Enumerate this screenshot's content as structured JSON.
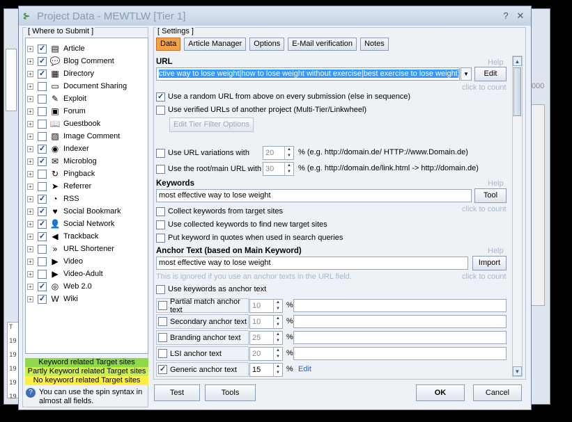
{
  "window": {
    "title": "Project Data - MEWTLW [Tier 1]"
  },
  "background": {
    "bottom_rows": [
      "T",
      "19",
      "19",
      "19",
      "19",
      "19"
    ],
    "right_text": "000"
  },
  "left_panel": {
    "label": "[ Where to Submit ]",
    "items": [
      {
        "label": "Article",
        "checked": true,
        "icon": "article-icon",
        "glyph": "▤"
      },
      {
        "label": "Blog Comment",
        "checked": true,
        "icon": "blog-comment-icon",
        "glyph": "💬"
      },
      {
        "label": "Directory",
        "checked": true,
        "icon": "directory-icon",
        "glyph": "▦"
      },
      {
        "label": "Document Sharing",
        "checked": false,
        "icon": "document-sharing-icon",
        "glyph": "▭"
      },
      {
        "label": "Exploit",
        "checked": false,
        "icon": "exploit-icon",
        "glyph": "✎"
      },
      {
        "label": "Forum",
        "checked": false,
        "icon": "forum-icon",
        "glyph": "▣"
      },
      {
        "label": "Guestbook",
        "checked": false,
        "icon": "guestbook-icon",
        "glyph": "📖"
      },
      {
        "label": "Image Comment",
        "checked": false,
        "icon": "image-comment-icon",
        "glyph": "▨"
      },
      {
        "label": "Indexer",
        "checked": true,
        "icon": "indexer-icon",
        "glyph": "◉"
      },
      {
        "label": "Microblog",
        "checked": true,
        "icon": "microblog-icon",
        "glyph": "✉"
      },
      {
        "label": "Pingback",
        "checked": false,
        "icon": "pingback-icon",
        "glyph": "↻"
      },
      {
        "label": "Referrer",
        "checked": false,
        "icon": "referrer-icon",
        "glyph": "➤"
      },
      {
        "label": "RSS",
        "checked": true,
        "icon": "rss-icon",
        "glyph": "◔"
      },
      {
        "label": "Social Bookmark",
        "checked": true,
        "icon": "social-bookmark-icon",
        "glyph": "♥"
      },
      {
        "label": "Social Network",
        "checked": true,
        "icon": "social-network-icon",
        "glyph": "👤"
      },
      {
        "label": "Trackback",
        "checked": true,
        "icon": "trackback-icon",
        "glyph": "◀"
      },
      {
        "label": "URL Shortener",
        "checked": false,
        "icon": "url-shortener-icon",
        "glyph": "»"
      },
      {
        "label": "Video",
        "checked": false,
        "icon": "video-icon",
        "glyph": "▶"
      },
      {
        "label": "Video-Adult",
        "checked": false,
        "icon": "video-adult-icon",
        "glyph": "▶"
      },
      {
        "label": "Web 2.0",
        "checked": true,
        "icon": "web20-icon",
        "glyph": "◎"
      },
      {
        "label": "Wiki",
        "checked": true,
        "icon": "wiki-icon",
        "glyph": "W"
      }
    ],
    "legend": [
      {
        "label": "Keyword related Target sites",
        "color": "#8fd84a"
      },
      {
        "label": "Partly Keyword related Target sites",
        "color": "#ccee55"
      },
      {
        "label": "No keyword related Target sites",
        "color": "#ffee44"
      }
    ],
    "hint": "You can use the spin syntax in almost all fields."
  },
  "settings": {
    "label": "[ Settings ]",
    "tabs": [
      "Data",
      "Article Manager",
      "Options",
      "E-Mail verification",
      "Notes"
    ],
    "active_tab": "Data",
    "url": {
      "title": "URL",
      "help": "Help",
      "value": "ctive way to lose weight|how to lose weight without exercise|best exercise to lose weight}",
      "edit": "Edit",
      "click_to_count": "click to count",
      "random_url": {
        "label": "Use a random URL from above on every submission (else in sequence)",
        "checked": true
      },
      "verified_urls": {
        "label": "Use verified URLs of another project (Multi-Tier/Linkwheel)",
        "checked": false
      },
      "edit_tier_filter": "Edit Tier Filter Options",
      "variations": {
        "label": "Use URL variations with",
        "checked": false,
        "value": "20",
        "suffix": "% (e.g. http://domain.de/ HTTP://www.Domain.de)"
      },
      "root_main": {
        "label": "Use the root/main URL with",
        "checked": false,
        "value": "30",
        "suffix": "% (e.g. http://domain.de/link.html -> http://domain.de)"
      }
    },
    "keywords": {
      "title": "Keywords",
      "help": "Help",
      "value": "most effective way to lose weight",
      "tool": "Tool",
      "click_to_count": "click to count",
      "options": [
        {
          "label": "Collect keywords from target sites",
          "checked": false
        },
        {
          "label": "Use collected keywords to find new target sites",
          "checked": false
        },
        {
          "label": "Put keyword in quotes when used in search queries",
          "checked": false
        }
      ]
    },
    "anchor": {
      "title": "Anchor Text (based on Main Keyword)",
      "help": "Help",
      "value": "most effective way to lose weight",
      "import": "Import",
      "note": "This is ignored if you use an anchor texts in the URL field.",
      "click_to_count": "click to count",
      "use_keywords": {
        "label": "Use keywords as anchor text",
        "checked": false
      },
      "rows": [
        {
          "label": "Partial match anchor text",
          "checked": false,
          "value": "10",
          "enabled": false
        },
        {
          "label": "Secondary anchor text",
          "checked": false,
          "value": "10",
          "enabled": false
        },
        {
          "label": "Branding anchor text",
          "checked": false,
          "value": "25",
          "enabled": false
        },
        {
          "label": "LSI anchor text",
          "checked": false,
          "value": "20",
          "enabled": false
        },
        {
          "label": "Generic anchor text",
          "checked": true,
          "value": "15",
          "enabled": true
        }
      ],
      "percent": "%",
      "edit_link": "Edit"
    }
  },
  "footer": {
    "test": "Test",
    "tools": "Tools",
    "ok": "OK",
    "cancel": "Cancel"
  }
}
